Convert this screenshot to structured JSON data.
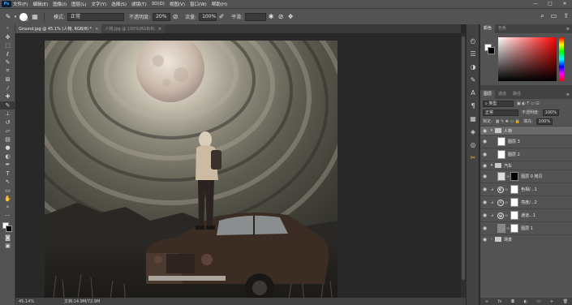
{
  "app": {
    "logo": "Ps",
    "window_controls": [
      "—",
      "□",
      "✕"
    ]
  },
  "menu": [
    "文件(F)",
    "编辑(E)",
    "图像(I)",
    "图层(L)",
    "文字(Y)",
    "选择(S)",
    "滤镜(T)",
    "3D(D)",
    "视图(V)",
    "窗口(W)",
    "帮助(H)"
  ],
  "options": {
    "brush_size": "300",
    "mode_label": "模式:",
    "mode_value": "正常",
    "opacity_label": "不透明度:",
    "opacity_value": "20%",
    "flow_label": "流量:",
    "flow_value": "100%",
    "smooth_label": "平滑:",
    "smooth_value": ""
  },
  "tabs": [
    {
      "label": "Ground.jpg @ 45.1% (人物, RGB/8) *",
      "close": "×",
      "active": true
    },
    {
      "label": "人物.jpg @ 100%(RGB/8)",
      "close": "×",
      "active": false
    }
  ],
  "status": {
    "zoom": "45.14%",
    "doc": "文档:14.9M/72.9M"
  },
  "panels": {
    "color_tabs": [
      "颜色",
      "色板"
    ],
    "layer_tabs": [
      "图层",
      "通道",
      "路径"
    ],
    "kind_filter": "类型",
    "blend_mode": "正常",
    "opacity_label": "不透明度:",
    "opacity_value": "100%",
    "lock_label": "锁定:",
    "fill_label": "填充:",
    "fill_value": "100%"
  },
  "layers": [
    {
      "name": "人物",
      "kind": "group",
      "expanded": true,
      "selected": true
    },
    {
      "name": "图层 3",
      "kind": "pixel"
    },
    {
      "name": "图层 2",
      "kind": "pixel"
    },
    {
      "name": "汽车",
      "kind": "group",
      "expanded": true
    },
    {
      "name": "图层 0 拷贝",
      "kind": "masked"
    },
    {
      "name": "色相/...1",
      "kind": "adjustment",
      "icon": "hue-sat-icon"
    },
    {
      "name": "亮度/...2",
      "kind": "adjustment",
      "icon": "brightness-icon"
    },
    {
      "name": "通道...1",
      "kind": "adjustment",
      "icon": "channel-mixer-icon"
    },
    {
      "name": "图层 1",
      "kind": "pixel-mask"
    },
    {
      "name": "场景",
      "kind": "group",
      "expanded": false
    }
  ],
  "colors": {
    "ui_dark": "#282828",
    "ui_panel": "#535353",
    "accent": "#31a8ff"
  }
}
